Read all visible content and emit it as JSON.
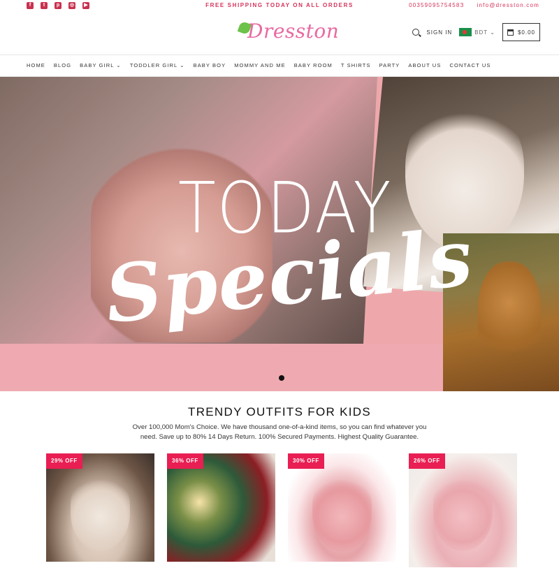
{
  "topbar": {
    "social": [
      {
        "name": "facebook",
        "glyph": "f"
      },
      {
        "name": "twitter",
        "glyph": "t"
      },
      {
        "name": "pinterest",
        "glyph": "p"
      },
      {
        "name": "instagram",
        "glyph": "◎"
      },
      {
        "name": "youtube",
        "glyph": "▶"
      }
    ],
    "shipping": "FREE SHIPPING TODAY ON ALL ORDERS",
    "phone": "0035909575458З",
    "email": "info@dresston.com"
  },
  "header": {
    "logo_text": "Dresston",
    "sign_in": "SIGN IN",
    "currency": "BDT ⌄",
    "cart_total": "$0.00"
  },
  "nav": {
    "items": [
      "HOME",
      "BLOG",
      "BABY GIRL ⌄",
      "TODDLER GIRL ⌄",
      "BABY BOY",
      "MOMMY AND ME",
      "BABY ROOM",
      "T SHIRTS",
      "PARTY",
      "ABOUT US",
      "CONTACT US"
    ]
  },
  "hero": {
    "line1": "TODAY",
    "line2": "Specials"
  },
  "section": {
    "title": "TRENDY OUTFITS FOR KIDS",
    "description": "Over 100,000 Mom's Choice. We have thousand  one-of-a-kind items, so you can find whatever you need.  Save up to 80% 14 Days Return. 100% Secured Payments. Highest Quality Guarantee."
  },
  "products": [
    {
      "badge": "29% OFF"
    },
    {
      "badge": "36% OFF"
    },
    {
      "badge": "30% OFF"
    },
    {
      "badge": "26% OFF"
    }
  ],
  "colors": {
    "accent": "#e91e52",
    "topbar_text": "#d6325a",
    "hero_pink": "#eeaab0"
  }
}
